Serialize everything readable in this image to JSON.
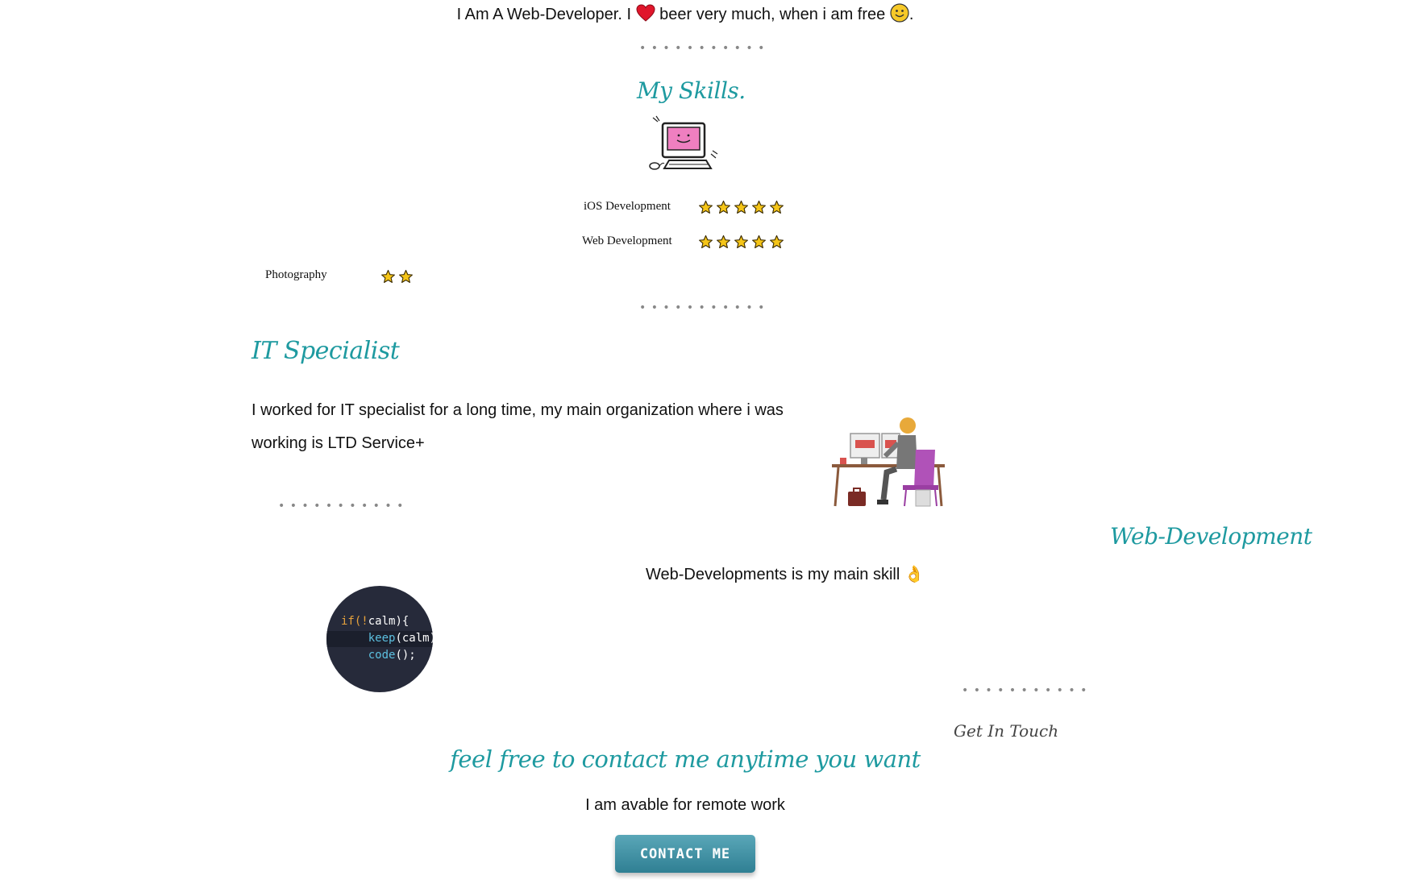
{
  "intro": {
    "part1": "I Am A Web-Developer. I",
    "part2": "beer very much, when i am free",
    "end": "."
  },
  "divider": "• • • • • • • • • • •",
  "skills": {
    "title": "My Skills.",
    "items": [
      {
        "label": "iOS Development",
        "stars": 5
      },
      {
        "label": "Web Development",
        "stars": 5
      },
      {
        "label": "Photography",
        "stars": 2
      }
    ]
  },
  "it_section": {
    "title": "IT Specialist",
    "text": "I worked for IT specialist for a long time, my main organization where i was working is LTD Service+"
  },
  "web_section": {
    "title": "Web-Development",
    "text": "Web-Developments is my main skill 👌",
    "code": [
      "if(!calm){",
      "    keep(calm);",
      "    code();"
    ]
  },
  "contact": {
    "small_title": "Get In Touch",
    "title": "feel free to contact me anytime you want",
    "subtitle": "I am avable for remote work",
    "button_label": "CONTACT ME"
  },
  "colors": {
    "accent": "#1e9aa0",
    "button": "#3b8fa2",
    "heart": "#e0162b",
    "star": "#f5c518"
  },
  "icons": [
    "heart-icon",
    "smiley-icon",
    "star-icon",
    "ok-hand-icon"
  ]
}
